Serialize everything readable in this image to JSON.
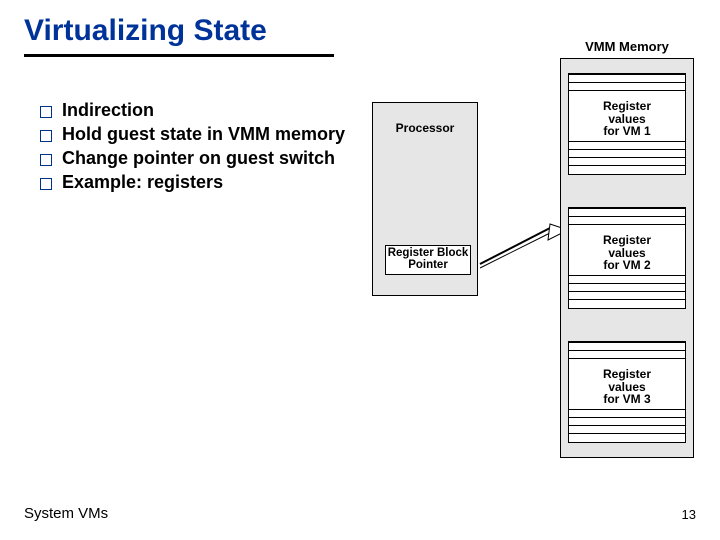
{
  "title": "Virtualizing State",
  "bullets": [
    "Indirection",
    "Hold guest state in VMM memory",
    "Change pointer on guest switch",
    "Example: registers"
  ],
  "processor": {
    "label": "Processor",
    "register_block": {
      "line1": "Register Block",
      "line2": "Pointer"
    }
  },
  "memory": {
    "title": "VMM Memory",
    "blocks": [
      {
        "line1": "Register",
        "line2": "values",
        "line3": "for VM 1"
      },
      {
        "line1": "Register",
        "line2": "values",
        "line3": "for VM 2"
      },
      {
        "line1": "Register",
        "line2": "values",
        "line3": "for VM 3"
      }
    ]
  },
  "footer": {
    "left": "System VMs",
    "right": "13"
  }
}
